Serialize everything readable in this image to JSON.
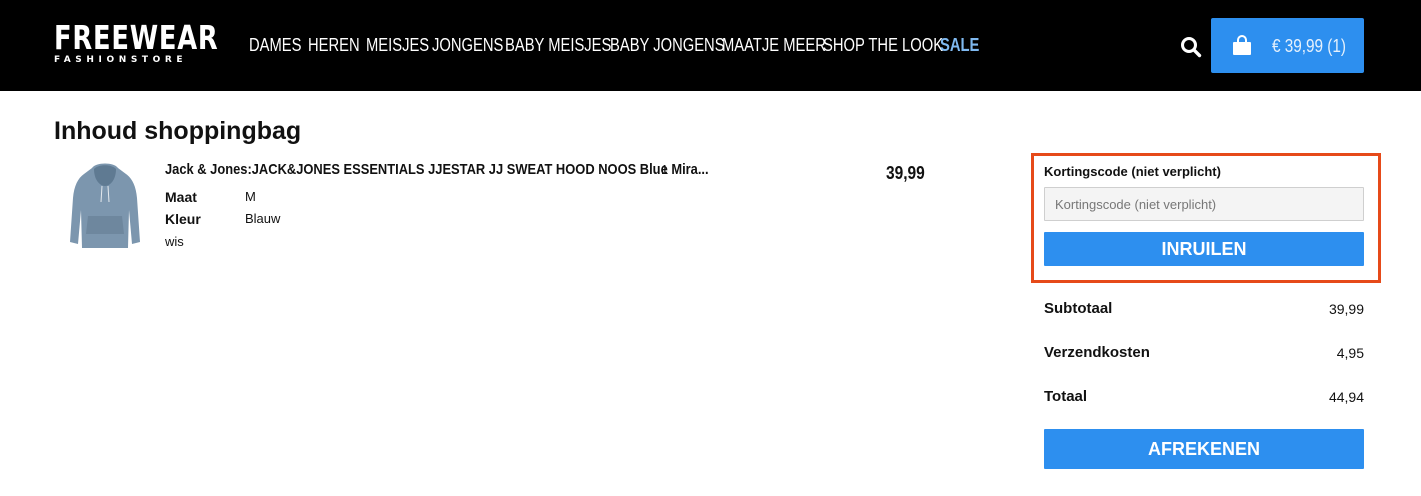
{
  "header": {
    "logo": {
      "main": "FREEWEAR",
      "sub": "FASHIONSTORE"
    },
    "nav": [
      {
        "label": "DAMES"
      },
      {
        "label": "HEREN"
      },
      {
        "label": "MEISJES"
      },
      {
        "label": "JONGENS"
      },
      {
        "label": "BABY MEISJES"
      },
      {
        "label": "BABY JONGENS"
      },
      {
        "label": "MAATJE MEER"
      },
      {
        "label": "SHOP THE LOOK"
      },
      {
        "label": "SALE"
      }
    ],
    "search_icon": "search-icon",
    "cart": {
      "icon": "shopping-bag-icon",
      "label": "€ 39,99 (1)"
    }
  },
  "main": {
    "title": "Inhoud shoppingbag",
    "item": {
      "name": "Jack & Jones:JACK&JONES ESSENTIALS JJESTAR JJ SWEAT HOOD NOOS Blue Mira...",
      "quantity": "1",
      "price": "39,99",
      "attributes": [
        {
          "label": "Maat",
          "value": "M"
        },
        {
          "label": "Kleur",
          "value": "Blauw"
        }
      ],
      "remove_label": "wis"
    }
  },
  "summary": {
    "discount": {
      "label": "Kortingscode (niet verplicht)",
      "placeholder": "Kortingscode (niet verplicht)",
      "value": "",
      "button": "INRUILEN"
    },
    "rows": [
      {
        "label": "Subtotaal",
        "value": "39,99"
      },
      {
        "label": "Verzendkosten",
        "value": "4,95"
      },
      {
        "label": "Totaal",
        "value": "44,94"
      }
    ],
    "checkout_button": "AFREKENEN"
  },
  "colors": {
    "header_bg": "#000000",
    "accent_blue": "#2d8fef",
    "sale_text": "#7fb9f0",
    "highlight_border": "#e64a19"
  }
}
